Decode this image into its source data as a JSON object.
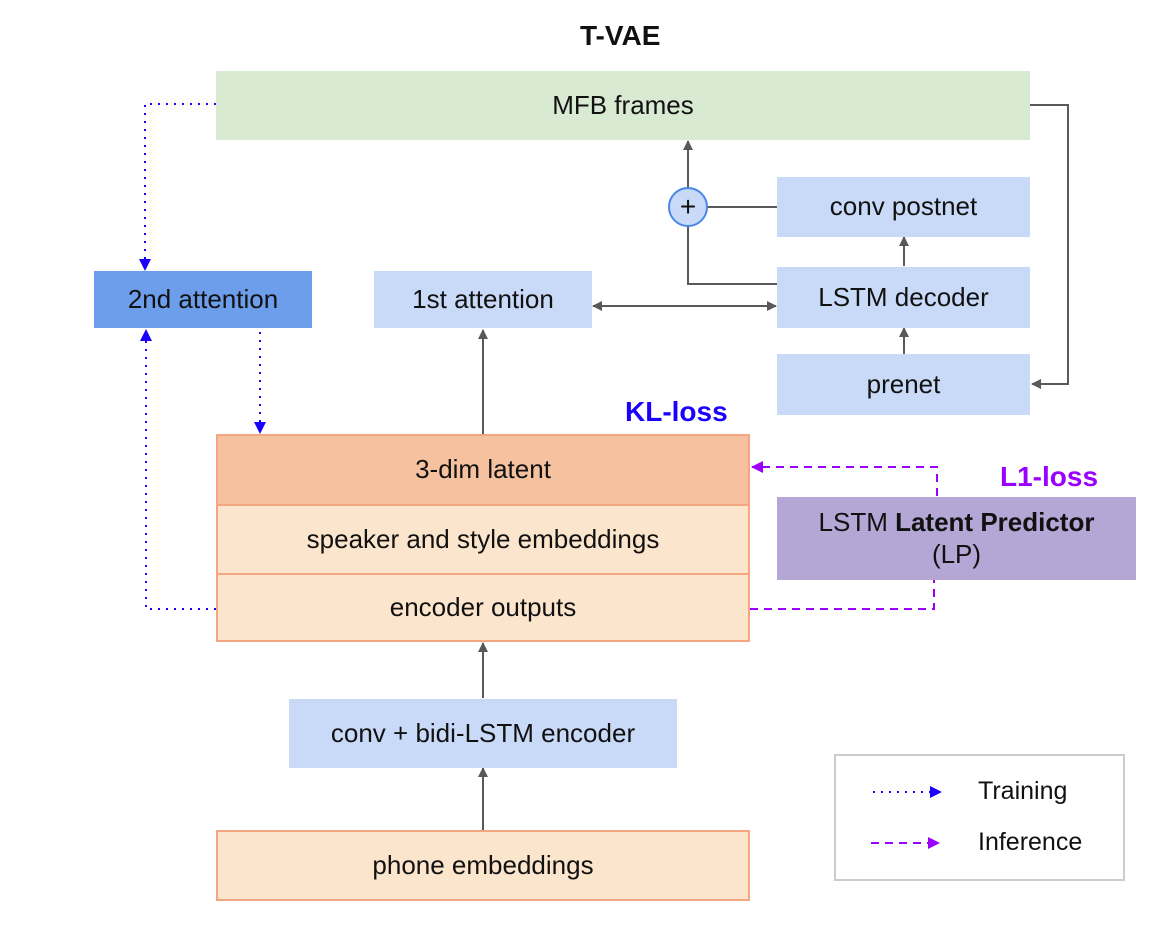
{
  "title": "T-VAE",
  "nodes": {
    "mfb_frames": "MFB frames",
    "conv_postnet": "conv postnet",
    "lstm_decoder": "LSTM decoder",
    "prenet": "prenet",
    "first_attention": "1st attention",
    "second_attention": "2nd attention",
    "latent": "3-dim latent",
    "speaker_style": "speaker and style embeddings",
    "encoder_outputs": "encoder outputs",
    "encoder": "conv + bidi-LSTM encoder",
    "phone_embeddings": "phone embeddings",
    "latent_predictor_prefix": "LSTM",
    "latent_predictor_bold": "Latent Predictor",
    "latent_predictor_abbrev": "(LP)",
    "sum_symbol": "+"
  },
  "losses": {
    "kl": "KL-loss",
    "l1": "L1-loss"
  },
  "legend": {
    "training": "Training",
    "inference": "Inference"
  },
  "colors": {
    "training": "#1a00ff",
    "inference": "#9b00ff",
    "arrow": "#595959",
    "second_attention": "#6d9eeb",
    "latent_predictor": "#b4a7d6"
  }
}
